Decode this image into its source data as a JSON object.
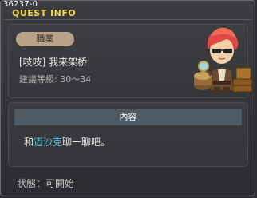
{
  "window": {
    "quest_id": "36237-0",
    "title": "QUEST INFO"
  },
  "quest": {
    "job_label": "職業",
    "name": "[吱吱] 我来架桥",
    "level_text": "建議等級: 30～34",
    "npc_icon": "npc-red-hair-sunglasses-portrait"
  },
  "content": {
    "header": "內容",
    "prefix": "和",
    "npc_name": "迈沙克",
    "suffix": "聊一聊吧。"
  },
  "status": {
    "text": "狀態：可開始"
  },
  "colors": {
    "title": "#f2d648",
    "npc_link": "#56c6e6",
    "job_tag": "#b9a489",
    "content_header": "#4d5a63"
  }
}
